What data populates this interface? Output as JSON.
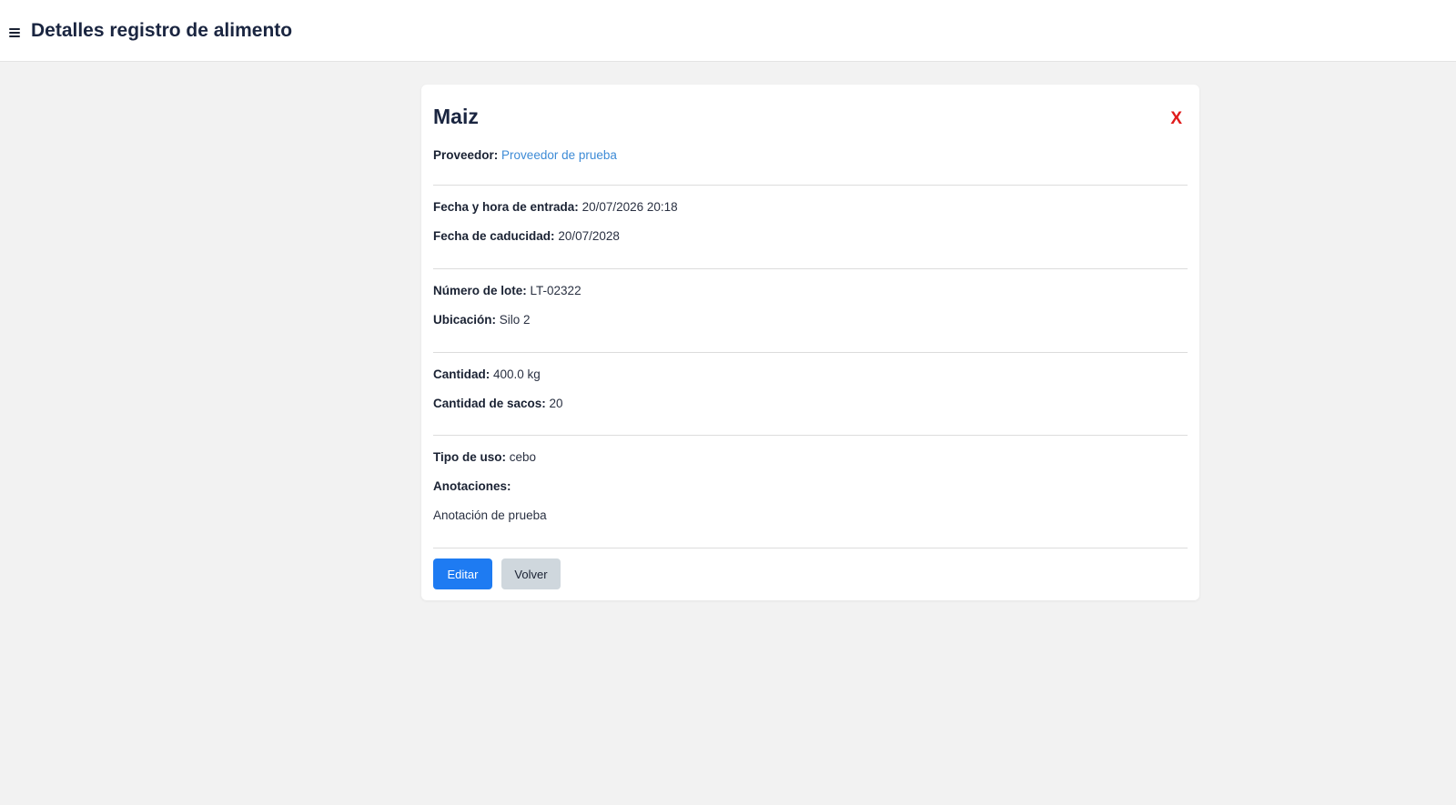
{
  "header": {
    "title": "Detalles registro de alimento"
  },
  "card": {
    "title": "Maiz",
    "close_label": "X",
    "proveedor": {
      "label": "Proveedor:",
      "value": "Proveedor de prueba"
    },
    "fecha_entrada": {
      "label": "Fecha y hora de entrada:",
      "value": "20/07/2026 20:18"
    },
    "fecha_caducidad": {
      "label": "Fecha de caducidad:",
      "value": "20/07/2028"
    },
    "numero_lote": {
      "label": "Número de lote:",
      "value": "LT-02322"
    },
    "ubicacion": {
      "label": "Ubicación:",
      "value": "Silo 2"
    },
    "cantidad": {
      "label": "Cantidad:",
      "value": "400.0 kg"
    },
    "cantidad_sacos": {
      "label": "Cantidad de sacos:",
      "value": "20"
    },
    "tipo_uso": {
      "label": "Tipo de uso:",
      "value": "cebo"
    },
    "anotaciones": {
      "label": "Anotaciones:",
      "value": "Anotación de prueba"
    },
    "buttons": {
      "edit": "Editar",
      "back": "Volver"
    }
  },
  "colors": {
    "primary": "#1e7bf2",
    "secondary": "#cfd7dd",
    "close": "#e01b1b",
    "link": "#3d8bd6"
  },
  "icons": {
    "menu": "hamburger-menu-icon"
  }
}
